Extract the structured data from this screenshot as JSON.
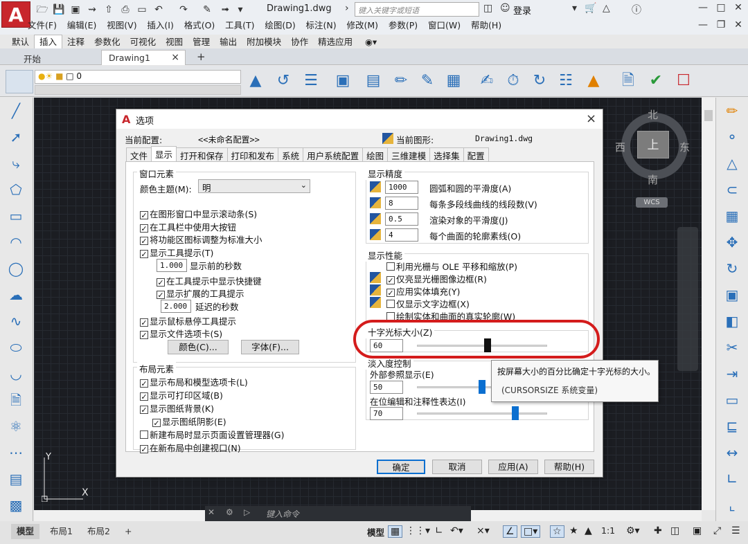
{
  "app": {
    "logo": "A",
    "doc_title": "Drawing1.dwg",
    "search_placeholder": "键入关键字或短语",
    "login": "登录"
  },
  "menu": [
    "文件(F)",
    "编辑(E)",
    "视图(V)",
    "插入(I)",
    "格式(O)",
    "工具(T)",
    "绘图(D)",
    "标注(N)",
    "修改(M)",
    "参数(P)",
    "窗口(W)",
    "帮助(H)"
  ],
  "ribbon_tabs": [
    "默认",
    "插入",
    "注释",
    "参数化",
    "可视化",
    "视图",
    "管理",
    "输出",
    "附加模块",
    "协作",
    "精选应用"
  ],
  "ribbon_active": "插入",
  "file_tabs": {
    "start": "开始",
    "drawing": "Drawing1",
    "close": "×",
    "add": "+"
  },
  "layer_value": "0",
  "viewcube": {
    "north": "北",
    "south": "南",
    "east": "东",
    "west": "西",
    "top": "上",
    "wcs": "WCS"
  },
  "ucs": {
    "y": "Y",
    "x": "X"
  },
  "command_placeholder": "键入命令",
  "status": {
    "tabs": [
      "模型",
      "布局1",
      "布局2",
      "+"
    ],
    "model": "模型",
    "scale": "1:1"
  },
  "dialog": {
    "title": "选项",
    "close": "×",
    "profile_label": "当前配置:",
    "profile_value": "<<未命名配置>>",
    "drawing_label": "当前图形:",
    "drawing_value": "Drawing1.dwg",
    "tabs": [
      "文件",
      "显示",
      "打开和保存",
      "打印和发布",
      "系统",
      "用户系统配置",
      "绘图",
      "三维建模",
      "选择集",
      "配置"
    ],
    "active_tab": "显示",
    "window_elements": {
      "title": "窗口元素",
      "color_theme_label": "颜色主题(M):",
      "color_theme_value": "明",
      "items": [
        "在图形窗口中显示滚动条(S)",
        "在工具栏中使用大按钮",
        "将功能区图标调整为标准大小",
        "显示工具提示(T)"
      ],
      "tooltip_delay_value": "1.000",
      "tooltip_delay_label": "显示前的秒数",
      "shortcut_item": "在工具提示中显示快捷键",
      "ext_item": "显示扩展的工具提示",
      "ext_delay_value": "2.000",
      "ext_delay_label": "延迟的秒数",
      "rollover_item": "显示鼠标悬停工具提示",
      "filetabs_item": "显示文件选项卡(S)",
      "colors_btn": "颜色(C)...",
      "fonts_btn": "字体(F)..."
    },
    "layout_elements": {
      "title": "布局元素",
      "items": [
        "显示布局和模型选项卡(L)",
        "显示可打印区域(B)",
        "显示图纸背景(K)"
      ],
      "shadow_item": "显示图纸阴影(E)",
      "new_layout_item": "新建布局时显示页面设置管理器(G)",
      "create_viewport_item": "在新布局中创建视口(N)"
    },
    "resolution": {
      "title": "显示精度",
      "rows": [
        {
          "value": "1000",
          "label": "圆弧和圆的平滑度(A)"
        },
        {
          "value": "8",
          "label": "每条多段线曲线的线段数(V)"
        },
        {
          "value": "0.5",
          "label": "渲染对象的平滑度(J)"
        },
        {
          "value": "4",
          "label": "每个曲面的轮廓素线(O)"
        }
      ]
    },
    "performance": {
      "title": "显示性能",
      "items": [
        {
          "label": "利用光栅与 OLE 平移和缩放(P)",
          "checked": false
        },
        {
          "label": "仅亮显光栅图像边框(R)",
          "checked": true
        },
        {
          "label": "应用实体填充(Y)",
          "checked": true
        },
        {
          "label": "仅显示文字边框(X)",
          "checked": false
        },
        {
          "label": "绘制实体和曲面的真实轮廓(W)",
          "checked": false
        }
      ]
    },
    "crosshair": {
      "title": "十字光标大小(Z)",
      "value": "60",
      "fraction": 0.6
    },
    "fade": {
      "title": "淡入度控制",
      "xref_label": "外部参照显示(E)",
      "xref_value": "50",
      "xref_fraction": 0.5,
      "inplace_label": "在位编辑和注释性表达(I)",
      "inplace_value": "70",
      "inplace_fraction": 0.7
    },
    "buttons": {
      "ok": "确定",
      "cancel": "取消",
      "apply": "应用(A)",
      "help": "帮助(H)"
    }
  },
  "tooltip": {
    "line1": "按屏幕大小的百分比确定十字光标的大小。",
    "line2": "(CURSORSIZE 系统变量)"
  },
  "colors": {
    "brand_red": "#c8262c",
    "canvas": "#1b1d22",
    "highlight": "#d41c1c",
    "slider_thumb": "#0b6fd0"
  }
}
